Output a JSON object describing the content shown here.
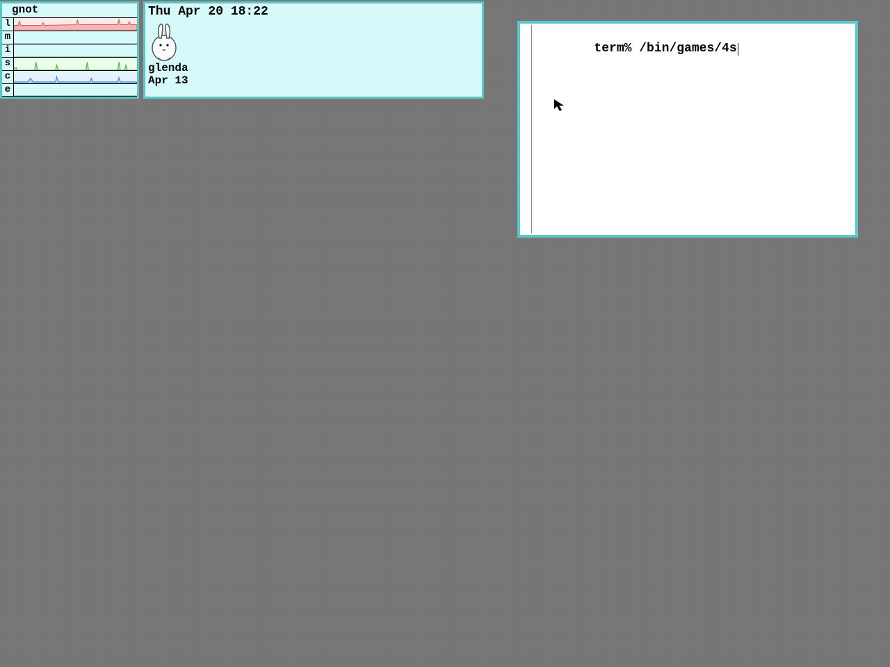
{
  "stats": {
    "title": "gnot",
    "rows": [
      {
        "label": "l",
        "color_fill": "#f4b5b5",
        "color_stroke": "#d06060",
        "bg": "#ffe9e9",
        "kind": "busy"
      },
      {
        "label": "m",
        "color_fill": "#d6fafa",
        "color_stroke": "#888",
        "bg": "#d6fafa",
        "kind": "flat"
      },
      {
        "label": "i",
        "color_fill": "#d6fafa",
        "color_stroke": "#888",
        "bg": "#d6fafa",
        "kind": "flat"
      },
      {
        "label": "s",
        "color_fill": "#b6e8b6",
        "color_stroke": "#4aa84a",
        "bg": "#e8ffe8",
        "kind": "spikes"
      },
      {
        "label": "c",
        "color_fill": "#b0d8f8",
        "color_stroke": "#3a80c8",
        "bg": "#e4f2ff",
        "kind": "spikes2"
      },
      {
        "label": "e",
        "color_fill": "#d6fafa",
        "color_stroke": "#888",
        "bg": "#d6fafa",
        "kind": "flat"
      }
    ]
  },
  "faces": {
    "datetime": "Thu Apr 20 18:22",
    "entries": [
      {
        "name": "glenda",
        "date": "Apr 13"
      }
    ]
  },
  "terminal": {
    "prompt": "term% ",
    "command": "/bin/games/4s"
  },
  "colors": {
    "accent": "#5ac8c8",
    "window_bg": "#d6fafa",
    "desktop": "#777777"
  }
}
